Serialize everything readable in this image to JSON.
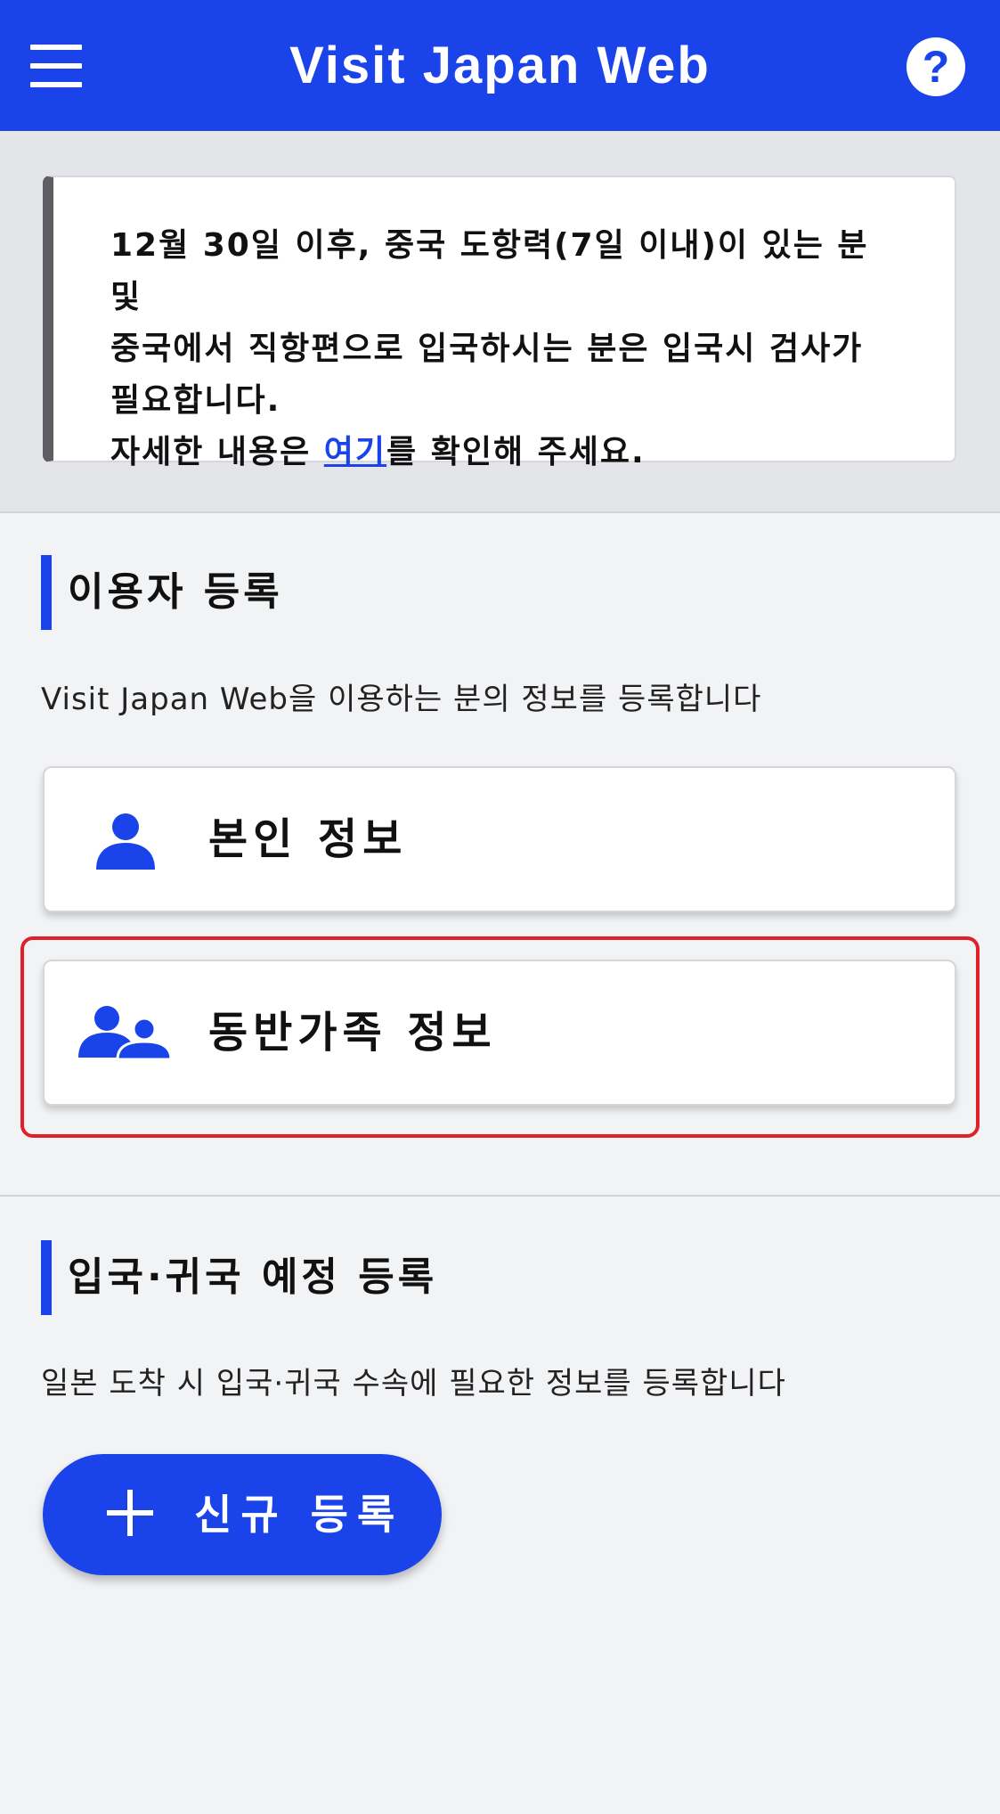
{
  "header": {
    "title": "Visit Japan Web",
    "menu_icon": "hamburger-menu-icon",
    "help_label": "?",
    "color": "#1a44ea"
  },
  "notice": {
    "line1": "12월 30일 이후, 중국 도항력(7일 이내)이 있는 분 및",
    "line2": "중국에서 직항편으로 입국하시는 분은 입국시 검사가",
    "line3": "필요합니다.",
    "line4_prefix": "자세한 내용은 ",
    "link_text": "여기",
    "line4_suffix": "를 확인해 주세요."
  },
  "user_registration": {
    "heading": "이용자 등록",
    "description": "Visit Japan Web을 이용하는 분의 정보를 등록합니다",
    "self_info_label": "본인 정보",
    "self_info_icon": "person-icon",
    "family_info_label": "동반가족 정보",
    "family_info_icon": "family-icon"
  },
  "trip_registration": {
    "heading": "입국·귀국 예정 등록",
    "description": "일본 도착 시 입국·귀국 수속에 필요한 정보를 등록합니다",
    "new_button_label": "신규 등록",
    "new_button_icon": "plus-icon"
  },
  "colors": {
    "accent": "#1a44ea",
    "highlight": "#e0202a"
  }
}
